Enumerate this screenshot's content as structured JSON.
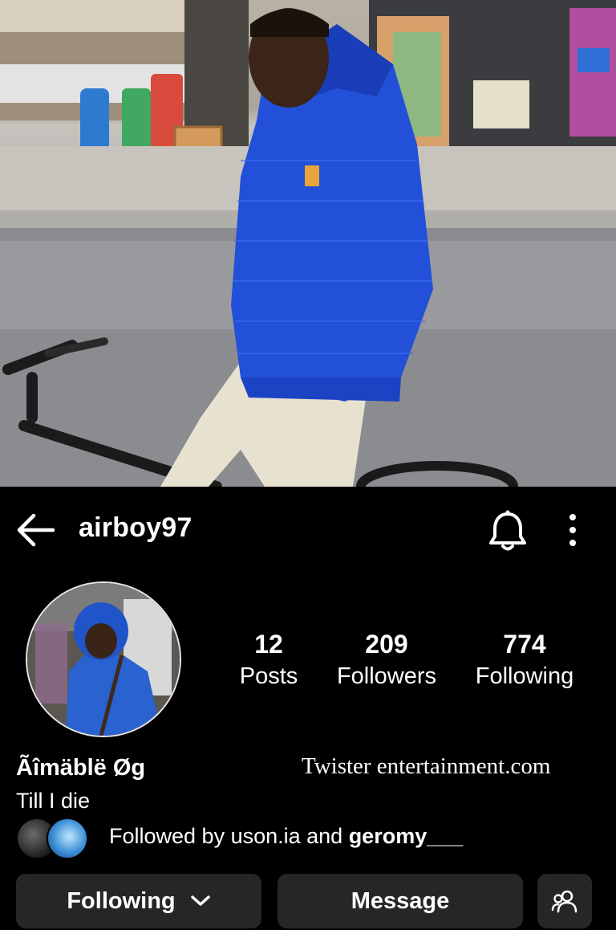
{
  "header": {
    "username": "airboy97",
    "back_icon": "arrow-left-icon",
    "notification_icon": "bell-icon",
    "more_icon": "vertical-dots-icon"
  },
  "profile": {
    "stats": [
      {
        "value": "12",
        "label": "Posts"
      },
      {
        "value": "209",
        "label": "Followers"
      },
      {
        "value": "774",
        "label": "Following"
      }
    ],
    "display_name": "Ãîmäblë Øg",
    "bio": "Till I die",
    "watermark": "Twister entertainment.com",
    "followed_by": {
      "prefix": "Followed by uson.ia and ",
      "highlight": "geromy___"
    }
  },
  "actions": {
    "following_label": "Following",
    "message_label": "Message",
    "suggest_icon": "add-people-icon"
  },
  "colors": {
    "background": "#000000",
    "button_bg": "#262626",
    "jacket_blue": "#1f4fd6"
  }
}
